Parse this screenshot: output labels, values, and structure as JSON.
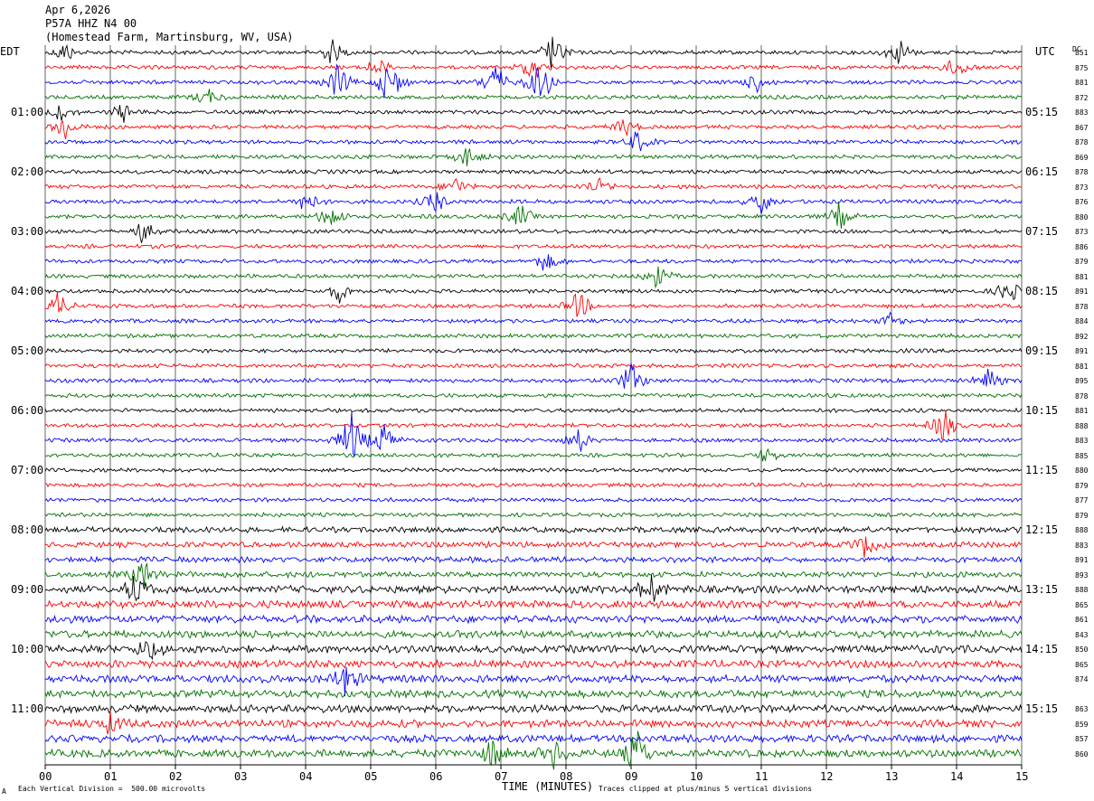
{
  "header": {
    "date": "Apr 6,2026",
    "station": "P57A HHZ N4 00",
    "location": "(Homestead Farm, Martinsburg, WV, USA)"
  },
  "left_tz": "EDT",
  "right_tz": "UTC",
  "dc_label": "DC",
  "footer": {
    "scale_note": "Each Vertical Division =  500.00 microvolts",
    "xlabel": "TIME (MINUTES)",
    "clip_note": "Traces clipped at plus/minus 5 vertical divisions",
    "corner_mark": "A"
  },
  "colors": {
    "trace_cycle": [
      "#000000",
      "#ff0000",
      "#0000ff",
      "#007000"
    ],
    "grid": "#000000"
  },
  "chart_data": {
    "type": "line",
    "title": "",
    "xlabel": "TIME (MINUTES)",
    "xlim": [
      0,
      15
    ],
    "x_ticks": [
      "00",
      "01",
      "02",
      "03",
      "04",
      "05",
      "06",
      "07",
      "08",
      "09",
      "10",
      "11",
      "12",
      "13",
      "14",
      "15"
    ],
    "left_time_labels": [
      "01:00",
      "02:00",
      "03:00",
      "04:00",
      "05:00",
      "06:00",
      "07:00",
      "08:00",
      "09:00",
      "10:00",
      "11:00"
    ],
    "right_time_labels": [
      "05:15",
      "06:15",
      "07:15",
      "08:15",
      "09:15",
      "10:15",
      "11:15",
      "12:15",
      "13:15",
      "14:15",
      "15:15"
    ],
    "trace_count": 48,
    "traces_per_hour": 4,
    "dc_offsets": [
      "851",
      "875",
      "881",
      "872",
      "883",
      "867",
      "878",
      "869",
      "878",
      "873",
      "876",
      "880",
      "873",
      "886",
      "879",
      "881",
      "891",
      "878",
      "884",
      "892",
      "891",
      "881",
      "895",
      "878",
      "881",
      "888",
      "883",
      "885",
      "880",
      "879",
      "877",
      "879",
      "888",
      "883",
      "891",
      "893",
      "888",
      "865",
      "861",
      "843",
      "850",
      "865",
      "874",
      "",
      "863",
      "859",
      "857",
      "860"
    ],
    "event_bursts": [
      {
        "trace": 0,
        "minute": 0.3,
        "amp": 1.2
      },
      {
        "trace": 0,
        "minute": 4.4,
        "amp": 1.3
      },
      {
        "trace": 0,
        "minute": 7.8,
        "amp": 2.0
      },
      {
        "trace": 0,
        "minute": 13.1,
        "amp": 1.5
      },
      {
        "trace": 1,
        "minute": 5.1,
        "amp": 1.0
      },
      {
        "trace": 1,
        "minute": 7.5,
        "amp": 1.8
      },
      {
        "trace": 1,
        "minute": 14.0,
        "amp": 1.6
      },
      {
        "trace": 2,
        "minute": 4.5,
        "amp": 1.8
      },
      {
        "trace": 2,
        "minute": 5.3,
        "amp": 3.2
      },
      {
        "trace": 2,
        "minute": 6.9,
        "amp": 2.4
      },
      {
        "trace": 2,
        "minute": 7.6,
        "amp": 3.0
      },
      {
        "trace": 2,
        "minute": 10.9,
        "amp": 1.3
      },
      {
        "trace": 3,
        "minute": 2.5,
        "amp": 1.0
      },
      {
        "trace": 4,
        "minute": 0.2,
        "amp": 1.2
      },
      {
        "trace": 4,
        "minute": 1.2,
        "amp": 1.0
      },
      {
        "trace": 5,
        "minute": 0.3,
        "amp": 1.4
      },
      {
        "trace": 5,
        "minute": 8.9,
        "amp": 1.0
      },
      {
        "trace": 6,
        "minute": 9.1,
        "amp": 1.3
      },
      {
        "trace": 7,
        "minute": 6.5,
        "amp": 1.3
      },
      {
        "trace": 9,
        "minute": 6.3,
        "amp": 1.0
      },
      {
        "trace": 9,
        "minute": 8.5,
        "amp": 1.2
      },
      {
        "trace": 10,
        "minute": 4.0,
        "amp": 1.5
      },
      {
        "trace": 10,
        "minute": 6.0,
        "amp": 1.5
      },
      {
        "trace": 10,
        "minute": 11.0,
        "amp": 1.5
      },
      {
        "trace": 11,
        "minute": 4.4,
        "amp": 1.6
      },
      {
        "trace": 11,
        "minute": 7.3,
        "amp": 1.4
      },
      {
        "trace": 11,
        "minute": 12.2,
        "amp": 1.6
      },
      {
        "trace": 12,
        "minute": 1.5,
        "amp": 1.3
      },
      {
        "trace": 14,
        "minute": 7.7,
        "amp": 1.2
      },
      {
        "trace": 15,
        "minute": 9.4,
        "amp": 1.4
      },
      {
        "trace": 16,
        "minute": 4.5,
        "amp": 1.3
      },
      {
        "trace": 16,
        "minute": 14.8,
        "amp": 1.4
      },
      {
        "trace": 17,
        "minute": 0.2,
        "amp": 1.4
      },
      {
        "trace": 17,
        "minute": 8.2,
        "amp": 1.6
      },
      {
        "trace": 18,
        "minute": 13.0,
        "amp": 1.0
      },
      {
        "trace": 22,
        "minute": 9.0,
        "amp": 2.0
      },
      {
        "trace": 22,
        "minute": 14.5,
        "amp": 1.5
      },
      {
        "trace": 25,
        "minute": 13.8,
        "amp": 2.0
      },
      {
        "trace": 26,
        "minute": 4.7,
        "amp": 3.0
      },
      {
        "trace": 26,
        "minute": 5.2,
        "amp": 2.0
      },
      {
        "trace": 26,
        "minute": 8.2,
        "amp": 1.5
      },
      {
        "trace": 27,
        "minute": 11.1,
        "amp": 1.0
      },
      {
        "trace": 33,
        "minute": 12.6,
        "amp": 1.2
      },
      {
        "trace": 35,
        "minute": 1.5,
        "amp": 1.5
      },
      {
        "trace": 36,
        "minute": 1.4,
        "amp": 2.0
      },
      {
        "trace": 36,
        "minute": 9.3,
        "amp": 1.5
      },
      {
        "trace": 40,
        "minute": 1.6,
        "amp": 1.5
      },
      {
        "trace": 42,
        "minute": 4.6,
        "amp": 1.8
      },
      {
        "trace": 45,
        "minute": 1.0,
        "amp": 1.0
      },
      {
        "trace": 47,
        "minute": 6.9,
        "amp": 1.8
      },
      {
        "trace": 47,
        "minute": 9.1,
        "amp": 2.6
      },
      {
        "trace": 47,
        "minute": 7.8,
        "amp": 1.5
      }
    ]
  }
}
